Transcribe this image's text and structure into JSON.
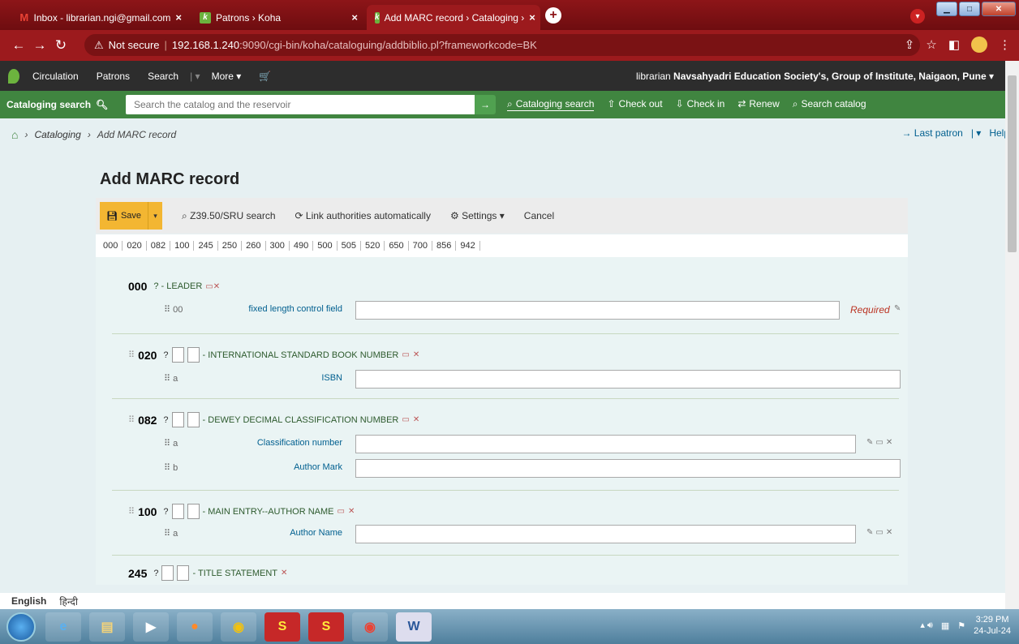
{
  "browser": {
    "tabs": [
      {
        "title": "Inbox - librarian.ngi@gmail.com",
        "favicon": "gmail-icon"
      },
      {
        "title": "Patrons › Koha",
        "favicon": "koha-icon"
      },
      {
        "title": "Add MARC record › Cataloging ›",
        "favicon": "koha-icon",
        "active": true
      }
    ],
    "security": "Not secure",
    "url_host": "192.168.1.240",
    "url_path": ":9090/cgi-bin/koha/cataloguing/addbiblio.pl?frameworkcode=BK"
  },
  "topnav": {
    "items": [
      "Circulation",
      "Patrons",
      "Search",
      "More"
    ],
    "user": "librarian",
    "library": "Navsahyadri Education Society's, Group of Institute, Naigaon, Pune"
  },
  "searchbar": {
    "label": "Cataloging search",
    "placeholder": "Search the catalog and the reservoir",
    "links": [
      "Cataloging search",
      "Check out",
      "Check in",
      "Renew",
      "Search catalog"
    ]
  },
  "breadcrumb": {
    "items": [
      "Cataloging",
      "Add MARC record"
    ]
  },
  "header_links": {
    "last_patron": "Last patron",
    "help": "Help"
  },
  "page": {
    "title": "Add MARC record",
    "toolbar": {
      "save": "Save",
      "z3950": "Z39.50/SRU search",
      "link_auth": "Link authorities automatically",
      "settings": "Settings",
      "cancel": "Cancel"
    },
    "tags": [
      "000",
      "020",
      "082",
      "100",
      "245",
      "250",
      "260",
      "300",
      "490",
      "500",
      "505",
      "520",
      "650",
      "700",
      "856",
      "942"
    ]
  },
  "fields": [
    {
      "tag": "000",
      "label": "? - LEADER",
      "subfields": [
        {
          "code": "00",
          "label": "fixed length control field",
          "required": "Required"
        }
      ]
    },
    {
      "tag": "020",
      "label": "- INTERNATIONAL STANDARD BOOK NUMBER",
      "subfields": [
        {
          "code": "a",
          "label": "ISBN"
        }
      ]
    },
    {
      "tag": "082",
      "label": "- DEWEY DECIMAL CLASSIFICATION NUMBER",
      "subfields": [
        {
          "code": "a",
          "label": "Classification number"
        },
        {
          "code": "b",
          "label": "Author Mark"
        }
      ]
    },
    {
      "tag": "100",
      "label": "- MAIN ENTRY--AUTHOR NAME",
      "subfields": [
        {
          "code": "a",
          "label": "Author Name"
        }
      ]
    },
    {
      "tag": "245",
      "label": "- TITLE STATEMENT",
      "subfields": []
    }
  ],
  "languages": {
    "current": "English",
    "other": "हिन्दी"
  },
  "taskbar": {
    "time": "3:29 PM",
    "date": "24-Jul-24"
  },
  "colors": {
    "accent": "#408540",
    "browser": "#9c1a1d",
    "save": "#f3b632"
  }
}
